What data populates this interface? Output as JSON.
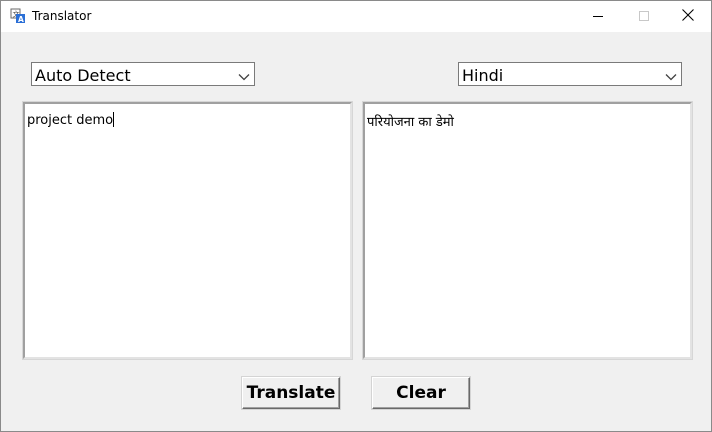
{
  "window": {
    "title": "Translator",
    "icon": "translate-app-icon",
    "controls": [
      "minimize-icon",
      "maximize-icon",
      "close-icon"
    ]
  },
  "source_language": {
    "selected": "Auto Detect"
  },
  "target_language": {
    "selected": "Hindi"
  },
  "input_text": "project demo",
  "output_text": "परियोजना का डेमो",
  "buttons": {
    "translate_label": "Translate",
    "clear_label": "Clear"
  },
  "colors": {
    "window_bg": "#f0f0f0",
    "titlebar_bg": "#ffffff",
    "textbox_bg": "#ffffff",
    "app_icon_blue": "#2b6fd6"
  }
}
